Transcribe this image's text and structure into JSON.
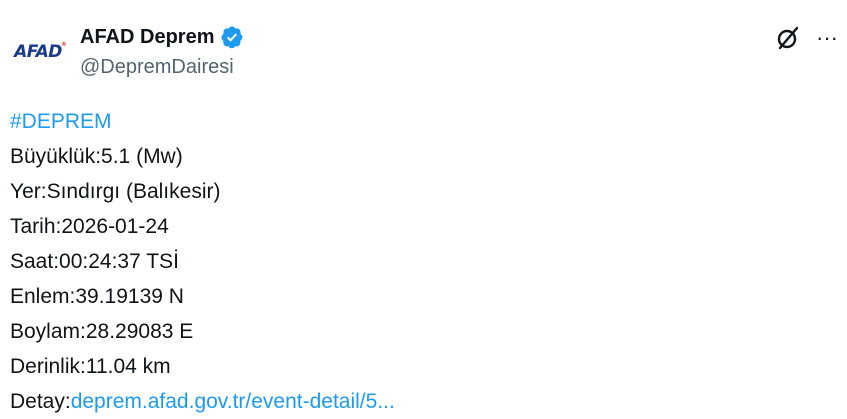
{
  "account": {
    "avatar_text": "AFAD",
    "avatar_mark": "®",
    "display_name": "AFAD Deprem",
    "handle": "@DepremDairesi",
    "verified_color": "#1d9bf0"
  },
  "actions": {
    "grok_icon": "grok-icon",
    "more_icon": "ellipsis-icon",
    "more_label": "···"
  },
  "post": {
    "hashtag": "#DEPREM",
    "magnitude": "Büyüklük:5.1 (Mw)",
    "location": "Yer:Sındırgı (Balıkesir)",
    "date": "Tarih:2026-01-24",
    "time": "Saat:00:24:37 TSİ",
    "latitude": "Enlem:39.19139 N",
    "longitude": "Boylam:28.29083 E",
    "depth": "Derinlik:11.04 km",
    "detail_label": "Detay:",
    "detail_link": "deprem.afad.gov.tr/event-detail/5..."
  },
  "colors": {
    "link": "#1d9bf0",
    "text": "#0f1419",
    "muted": "#536471"
  }
}
